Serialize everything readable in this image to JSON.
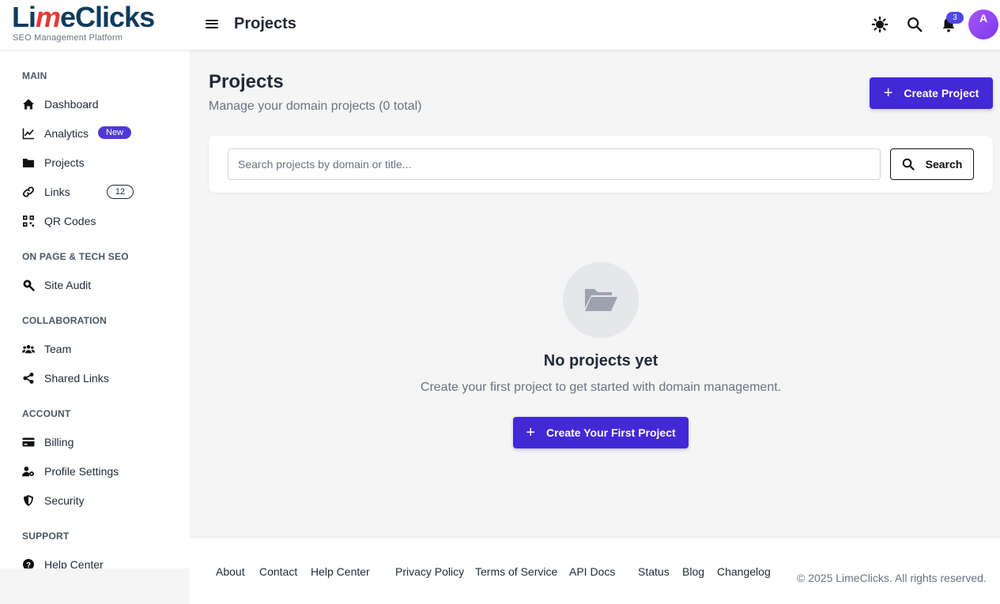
{
  "brand": {
    "name_left": "Li",
    "name_mid": "m",
    "name_right": "eClicks",
    "tagline": "SEO Management Platform"
  },
  "header": {
    "title": "Projects",
    "notification_count": "3",
    "avatar_initial": "A"
  },
  "sidebar": {
    "sections": {
      "main": "MAIN",
      "onpage": "ON PAGE & TECH SEO",
      "collab": "COLLABORATION",
      "account": "ACCOUNT",
      "support": "SUPPORT"
    },
    "items": {
      "dashboard": "Dashboard",
      "analytics": "Analytics",
      "analytics_badge": "New",
      "projects": "Projects",
      "links": "Links",
      "links_count": "12",
      "qr": "QR Codes",
      "site_audit": "Site Audit",
      "team": "Team",
      "shared_links": "Shared Links",
      "billing": "Billing",
      "profile_settings": "Profile Settings",
      "security": "Security",
      "help_center": "Help Center"
    }
  },
  "main": {
    "title": "Projects",
    "subtitle": "Manage your domain projects (0 total)",
    "create_button": "Create Project",
    "search_placeholder": "Search projects by domain or title...",
    "search_button": "Search",
    "empty_title": "No projects yet",
    "empty_subtitle": "Create your first project to get started with domain management.",
    "empty_button": "Create Your First Project"
  },
  "footer": {
    "links": {
      "about": "About",
      "contact": "Contact",
      "help": "Help Center",
      "privacy": "Privacy Policy",
      "terms": "Terms of Service",
      "api": "API Docs",
      "status": "Status",
      "blog": "Blog",
      "changelog": "Changelog"
    },
    "copyright": "© 2025 LimeClicks. All rights reserved."
  },
  "colors": {
    "primary": "#4328d6",
    "brand_dark": "#0f3b5c",
    "brand_accent": "#e53935"
  }
}
